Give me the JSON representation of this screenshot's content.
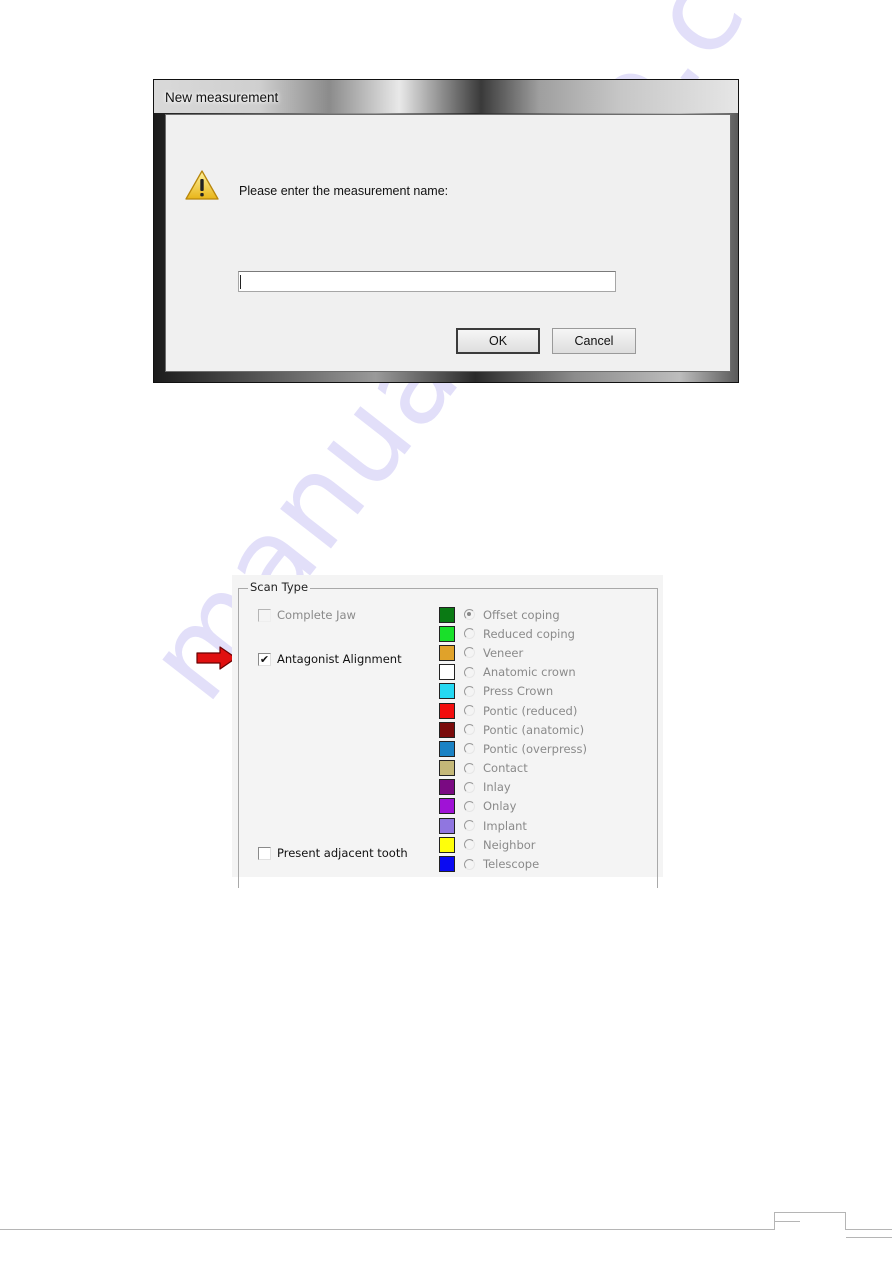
{
  "dialog": {
    "title": "New measurement",
    "icon": "warning-icon",
    "prompt": "Please enter the measurement name:",
    "input_value": "",
    "ok_label": "OK",
    "cancel_label": "Cancel"
  },
  "scan_type": {
    "group_label": "Scan Type",
    "checkboxes": [
      {
        "label": "Complete Jaw",
        "checked": false,
        "enabled": false
      },
      {
        "label": "Antagonist Alignment",
        "checked": true,
        "enabled": true
      },
      {
        "label": "Present adjacent tooth",
        "checked": false,
        "enabled": true
      }
    ],
    "check_glyph": "✔",
    "types": [
      {
        "label": "Offset coping",
        "color": "#0a7a14",
        "selected": true
      },
      {
        "label": "Reduced coping",
        "color": "#19e02a",
        "selected": false
      },
      {
        "label": "Veneer",
        "color": "#e0a22a",
        "selected": false
      },
      {
        "label": "Anatomic crown",
        "color": "#ffffff",
        "selected": false
      },
      {
        "label": "Press Crown",
        "color": "#25d8f2",
        "selected": false
      },
      {
        "label": "Pontic (reduced)",
        "color": "#f20d0d",
        "selected": false
      },
      {
        "label": "Pontic (anatomic)",
        "color": "#7a0a0a",
        "selected": false
      },
      {
        "label": "Pontic (overpress)",
        "color": "#1a82c4",
        "selected": false
      },
      {
        "label": "Contact",
        "color": "#c4b878",
        "selected": false
      },
      {
        "label": "Inlay",
        "color": "#7a0a82",
        "selected": false
      },
      {
        "label": "Onlay",
        "color": "#a012d6",
        "selected": false
      },
      {
        "label": "Implant",
        "color": "#9076e0",
        "selected": false
      },
      {
        "label": "Neighbor",
        "color": "#ffff0a",
        "selected": false
      },
      {
        "label": "Telescope",
        "color": "#0a0af2",
        "selected": false
      }
    ]
  },
  "annotation": {
    "arrow_color": "#e01010",
    "points_to": "Antagonist Alignment"
  },
  "watermark": "manualshive.com"
}
